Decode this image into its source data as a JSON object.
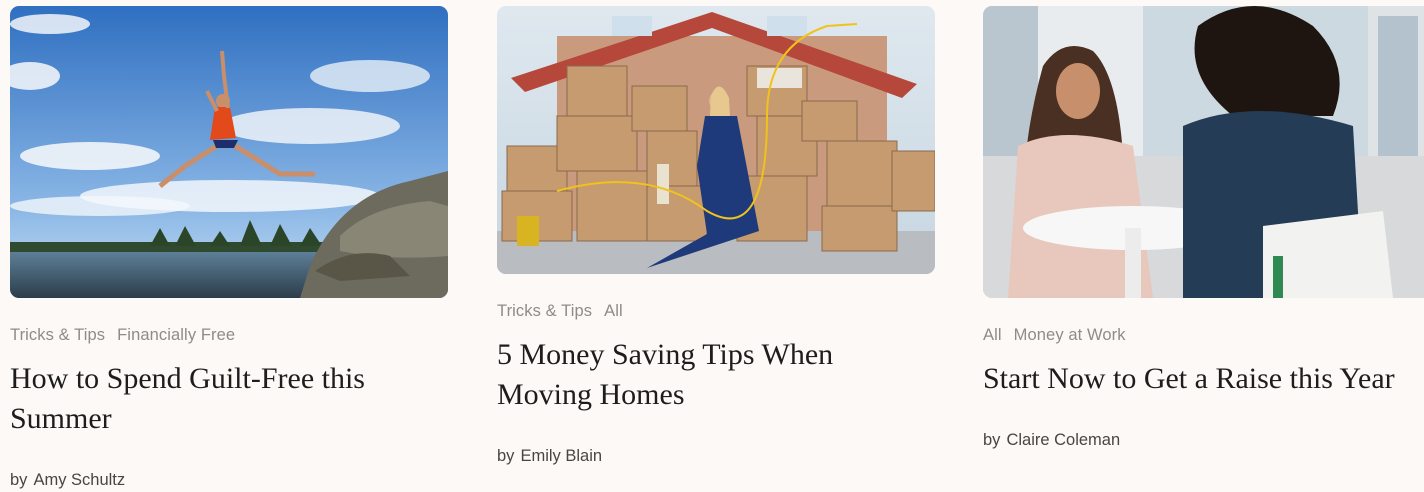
{
  "articles": [
    {
      "tags": [
        "Tricks & Tips",
        "Financially Free"
      ],
      "title": "How to Spend Guilt-Free this Summer",
      "by": "by",
      "author": "Amy Schultz"
    },
    {
      "tags": [
        "Tricks & Tips",
        "All"
      ],
      "title": "5 Money Saving Tips When Moving Homes",
      "by": "by",
      "author": "Emily Blain"
    },
    {
      "tags": [
        "All",
        "Money at Work"
      ],
      "title": "Start Now to Get a Raise this Year",
      "by": "by",
      "author": "Claire Coleman"
    }
  ],
  "colors": {
    "background": "#fdf9f6",
    "tag_text": "#8f8b88",
    "title_text": "#1d1d1d",
    "byline_text": "#4a4542"
  }
}
